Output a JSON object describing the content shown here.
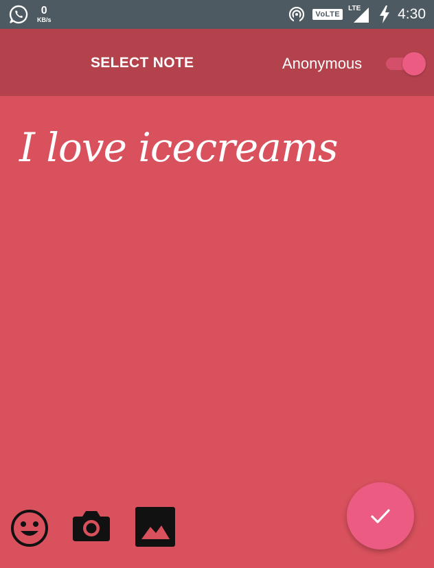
{
  "status_bar": {
    "data_speed": "0",
    "data_unit": "KB/s",
    "volte": "VoLTE",
    "lte": "LTE",
    "time": "4:30"
  },
  "app_bar": {
    "title": "SELECT NOTE",
    "anonymous_label": "Anonymous",
    "anonymous_on": true
  },
  "note": {
    "text": "I love icecreams"
  },
  "toolbar": {
    "icons": [
      "emoji-icon",
      "camera-icon",
      "image-icon"
    ]
  },
  "colors": {
    "status_bar": "#4e5a61",
    "app_bar": "#b3424d",
    "note_background": "#d9515d",
    "accent": "#ec5b82"
  }
}
